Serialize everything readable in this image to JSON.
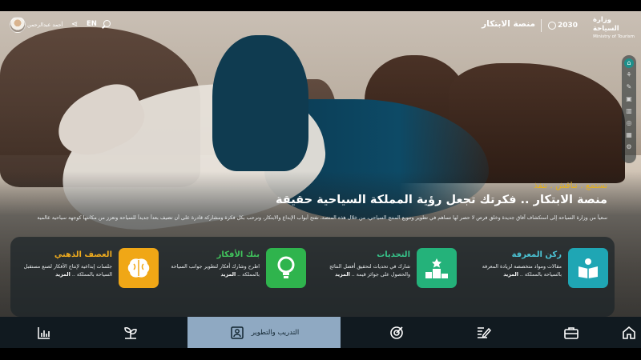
{
  "header": {
    "ministry_ar": "وزارة السياحة",
    "ministry_en": "Ministry of Tourism",
    "vision": "2030",
    "platform": "منصة الابتكار",
    "language": "EN",
    "user_name": "أحمد عبدالرحمن"
  },
  "hero": {
    "tagline": "نستمع . نناقش . ننفذ",
    "headline": "منصة الابتكار .. فكرتك تجعل رؤية المملكة السياحية حقيقة",
    "intro": "سعياً من وزارة السياحة إلى استكشاف آفاق جديدة وخلق فرص لا حصر لها تساهم في تطوير وتنويع المنتج السياحي، من خلال هذه المنصة، نفتح أبواب الإبداع والابتكار، ونرحب بكل فكرة ومشاركة قادرة على أن تضيف بعداً جديداً للسياحة وتعزز من مكانتها كوجهة سياحية عالمية"
  },
  "cards": [
    {
      "title": "ركن المعرفة",
      "desc": "مقالات ومواد متخصصة لزيادة المعرفة بالسياحة بالمملكة ..",
      "more": "المزيد",
      "color": "#1fa6b4",
      "icon": "book-icon"
    },
    {
      "title": "التحديات",
      "desc": "شارك في تحديات لتحقيق أفضل النتائج والحصول على جوائز قيمة ..",
      "more": "المزيد",
      "color": "#24b27a",
      "icon": "podium-icon"
    },
    {
      "title": "بنك الأفكار",
      "desc": "اطرح وشارك أفكار لتطوير جوانب السياحة بالمملكة ..",
      "more": "المزيد",
      "color": "#2fb44d",
      "icon": "lightbulb-icon"
    },
    {
      "title": "العصف الذهني",
      "desc": "جلسات إبداعية لإنتاج الأفكار لصنع مستقبل السياحة بالمملكة ..",
      "more": "المزيد",
      "color": "#f0a716",
      "icon": "brain-icon"
    }
  ],
  "bottom_nav": {
    "active_label": "التدريب والتطوير",
    "items": [
      "home-icon",
      "briefcase-icon",
      "edit-icon",
      "target-icon",
      "training-icon",
      "plant-icon",
      "stats-icon"
    ]
  },
  "colors": {
    "accent_gold": "#e5b11c",
    "nav_active": "#8fa9c2",
    "rail_active": "#1e8f8a"
  }
}
